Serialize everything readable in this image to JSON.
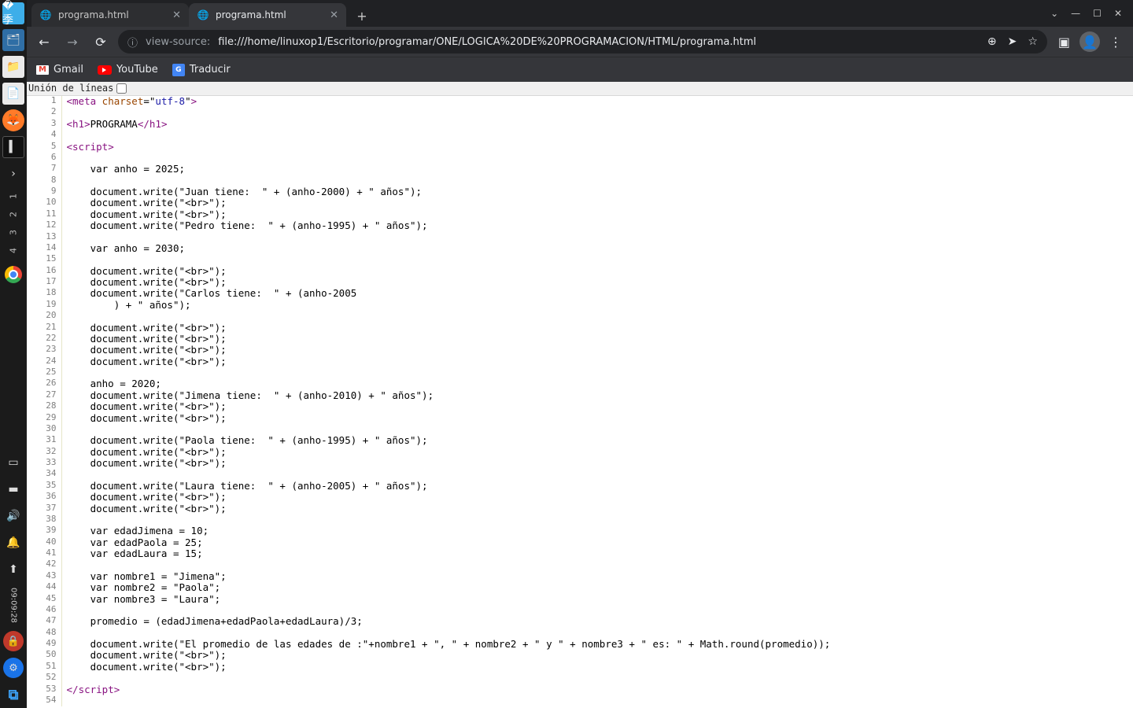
{
  "tabs": {
    "t0": {
      "title": "programa.html"
    },
    "t1": {
      "title": "programa.html"
    }
  },
  "window_controls": {
    "min": "—",
    "max": "☐",
    "close": "✕",
    "drop": "⌄"
  },
  "toolbar": {
    "back": "←",
    "fwd": "→",
    "reload": "⟳",
    "url_info_glyph": "ⓘ",
    "url_scheme": "view-source:",
    "url_rest": "file:///home/linuxop1/Escritorio/programar/ONE/LOGICA%20DE%20PROGRAMACION/HTML/programa.html",
    "zoom": "⊕",
    "share": "➤",
    "star": "☆",
    "panel": "▣",
    "menu": "⋮"
  },
  "bookmarks": {
    "gmail": "Gmail",
    "youtube": "YouTube",
    "traducir": "Traducir"
  },
  "linewrap_label": "Unión de líneas",
  "clock": "09:09:28",
  "source": {
    "lines": [
      {
        "n": 1,
        "segs": [
          {
            "c": "tag-ang",
            "t": "<"
          },
          {
            "c": "tag-name",
            "t": "meta"
          },
          {
            "c": "plain",
            "t": " "
          },
          {
            "c": "attr-name",
            "t": "charset"
          },
          {
            "c": "plain",
            "t": "=\""
          },
          {
            "c": "attr-val",
            "t": "utf-8"
          },
          {
            "c": "plain",
            "t": "\""
          },
          {
            "c": "tag-ang",
            "t": ">"
          }
        ]
      },
      {
        "n": 2,
        "segs": []
      },
      {
        "n": 3,
        "segs": [
          {
            "c": "tag-ang",
            "t": "<"
          },
          {
            "c": "tag-name",
            "t": "h1"
          },
          {
            "c": "tag-ang",
            "t": ">"
          },
          {
            "c": "plain",
            "t": "PROGRAMA"
          },
          {
            "c": "tag-ang",
            "t": "</"
          },
          {
            "c": "tag-name",
            "t": "h1"
          },
          {
            "c": "tag-ang",
            "t": ">"
          }
        ]
      },
      {
        "n": 4,
        "segs": []
      },
      {
        "n": 5,
        "segs": [
          {
            "c": "tag-ang",
            "t": "<"
          },
          {
            "c": "tag-name",
            "t": "script"
          },
          {
            "c": "tag-ang",
            "t": ">"
          }
        ]
      },
      {
        "n": 6,
        "segs": []
      },
      {
        "n": 7,
        "segs": [
          {
            "c": "plain",
            "t": "    var anho = 2025;"
          }
        ]
      },
      {
        "n": 8,
        "segs": []
      },
      {
        "n": 9,
        "segs": [
          {
            "c": "plain",
            "t": "    document.write(\"Juan tiene:  \" + (anho-2000) + \" años\");"
          }
        ]
      },
      {
        "n": 10,
        "segs": [
          {
            "c": "plain",
            "t": "    document.write(\"<br>\");"
          }
        ]
      },
      {
        "n": 11,
        "segs": [
          {
            "c": "plain",
            "t": "    document.write(\"<br>\");"
          }
        ]
      },
      {
        "n": 12,
        "segs": [
          {
            "c": "plain",
            "t": "    document.write(\"Pedro tiene:  \" + (anho-1995) + \" años\");"
          }
        ]
      },
      {
        "n": 13,
        "segs": []
      },
      {
        "n": 14,
        "segs": [
          {
            "c": "plain",
            "t": "    var anho = 2030;"
          }
        ]
      },
      {
        "n": 15,
        "segs": []
      },
      {
        "n": 16,
        "segs": [
          {
            "c": "plain",
            "t": "    document.write(\"<br>\");"
          }
        ]
      },
      {
        "n": 17,
        "segs": [
          {
            "c": "plain",
            "t": "    document.write(\"<br>\");"
          }
        ]
      },
      {
        "n": 18,
        "segs": [
          {
            "c": "plain",
            "t": "    document.write(\"Carlos tiene:  \" + (anho-2005"
          }
        ]
      },
      {
        "n": 19,
        "segs": [
          {
            "c": "plain",
            "t": "        ) + \" años\");"
          }
        ]
      },
      {
        "n": 20,
        "segs": []
      },
      {
        "n": 21,
        "segs": [
          {
            "c": "plain",
            "t": "    document.write(\"<br>\");"
          }
        ]
      },
      {
        "n": 22,
        "segs": [
          {
            "c": "plain",
            "t": "    document.write(\"<br>\");"
          }
        ]
      },
      {
        "n": 23,
        "segs": [
          {
            "c": "plain",
            "t": "    document.write(\"<br>\");"
          }
        ]
      },
      {
        "n": 24,
        "segs": [
          {
            "c": "plain",
            "t": "    document.write(\"<br>\");"
          }
        ]
      },
      {
        "n": 25,
        "segs": []
      },
      {
        "n": 26,
        "segs": [
          {
            "c": "plain",
            "t": "    anho = 2020;"
          }
        ]
      },
      {
        "n": 27,
        "segs": [
          {
            "c": "plain",
            "t": "    document.write(\"Jimena tiene:  \" + (anho-2010) + \" años\");"
          }
        ]
      },
      {
        "n": 28,
        "segs": [
          {
            "c": "plain",
            "t": "    document.write(\"<br>\");"
          }
        ]
      },
      {
        "n": 29,
        "segs": [
          {
            "c": "plain",
            "t": "    document.write(\"<br>\");"
          }
        ]
      },
      {
        "n": 30,
        "segs": []
      },
      {
        "n": 31,
        "segs": [
          {
            "c": "plain",
            "t": "    document.write(\"Paola tiene:  \" + (anho-1995) + \" años\");"
          }
        ]
      },
      {
        "n": 32,
        "segs": [
          {
            "c": "plain",
            "t": "    document.write(\"<br>\");"
          }
        ]
      },
      {
        "n": 33,
        "segs": [
          {
            "c": "plain",
            "t": "    document.write(\"<br>\");"
          }
        ]
      },
      {
        "n": 34,
        "segs": []
      },
      {
        "n": 35,
        "segs": [
          {
            "c": "plain",
            "t": "    document.write(\"Laura tiene:  \" + (anho-2005) + \" años\");"
          }
        ]
      },
      {
        "n": 36,
        "segs": [
          {
            "c": "plain",
            "t": "    document.write(\"<br>\");"
          }
        ]
      },
      {
        "n": 37,
        "segs": [
          {
            "c": "plain",
            "t": "    document.write(\"<br>\");"
          }
        ]
      },
      {
        "n": 38,
        "segs": []
      },
      {
        "n": 39,
        "segs": [
          {
            "c": "plain",
            "t": "    var edadJimena = 10;"
          }
        ]
      },
      {
        "n": 40,
        "segs": [
          {
            "c": "plain",
            "t": "    var edadPaola = 25;"
          }
        ]
      },
      {
        "n": 41,
        "segs": [
          {
            "c": "plain",
            "t": "    var edadLaura = 15;"
          }
        ]
      },
      {
        "n": 42,
        "segs": []
      },
      {
        "n": 43,
        "segs": [
          {
            "c": "plain",
            "t": "    var nombre1 = \"Jimena\";"
          }
        ]
      },
      {
        "n": 44,
        "segs": [
          {
            "c": "plain",
            "t": "    var nombre2 = \"Paola\";"
          }
        ]
      },
      {
        "n": 45,
        "segs": [
          {
            "c": "plain",
            "t": "    var nombre3 = \"Laura\";"
          }
        ]
      },
      {
        "n": 46,
        "segs": []
      },
      {
        "n": 47,
        "segs": [
          {
            "c": "plain",
            "t": "    promedio = (edadJimena+edadPaola+edadLaura)/3;"
          }
        ]
      },
      {
        "n": 48,
        "segs": []
      },
      {
        "n": 49,
        "segs": [
          {
            "c": "plain",
            "t": "    document.write(\"El promedio de las edades de :\"+nombre1 + \", \" + nombre2 + \" y \" + nombre3 + \" es: \" + Math.round(promedio));"
          }
        ]
      },
      {
        "n": 50,
        "segs": [
          {
            "c": "plain",
            "t": "    document.write(\"<br>\");"
          }
        ]
      },
      {
        "n": 51,
        "segs": [
          {
            "c": "plain",
            "t": "    document.write(\"<br>\");"
          }
        ]
      },
      {
        "n": 52,
        "segs": []
      },
      {
        "n": 53,
        "segs": [
          {
            "c": "tag-ang",
            "t": "</"
          },
          {
            "c": "tag-name",
            "t": "script"
          },
          {
            "c": "tag-ang",
            "t": ">"
          }
        ]
      },
      {
        "n": 54,
        "segs": []
      }
    ]
  }
}
